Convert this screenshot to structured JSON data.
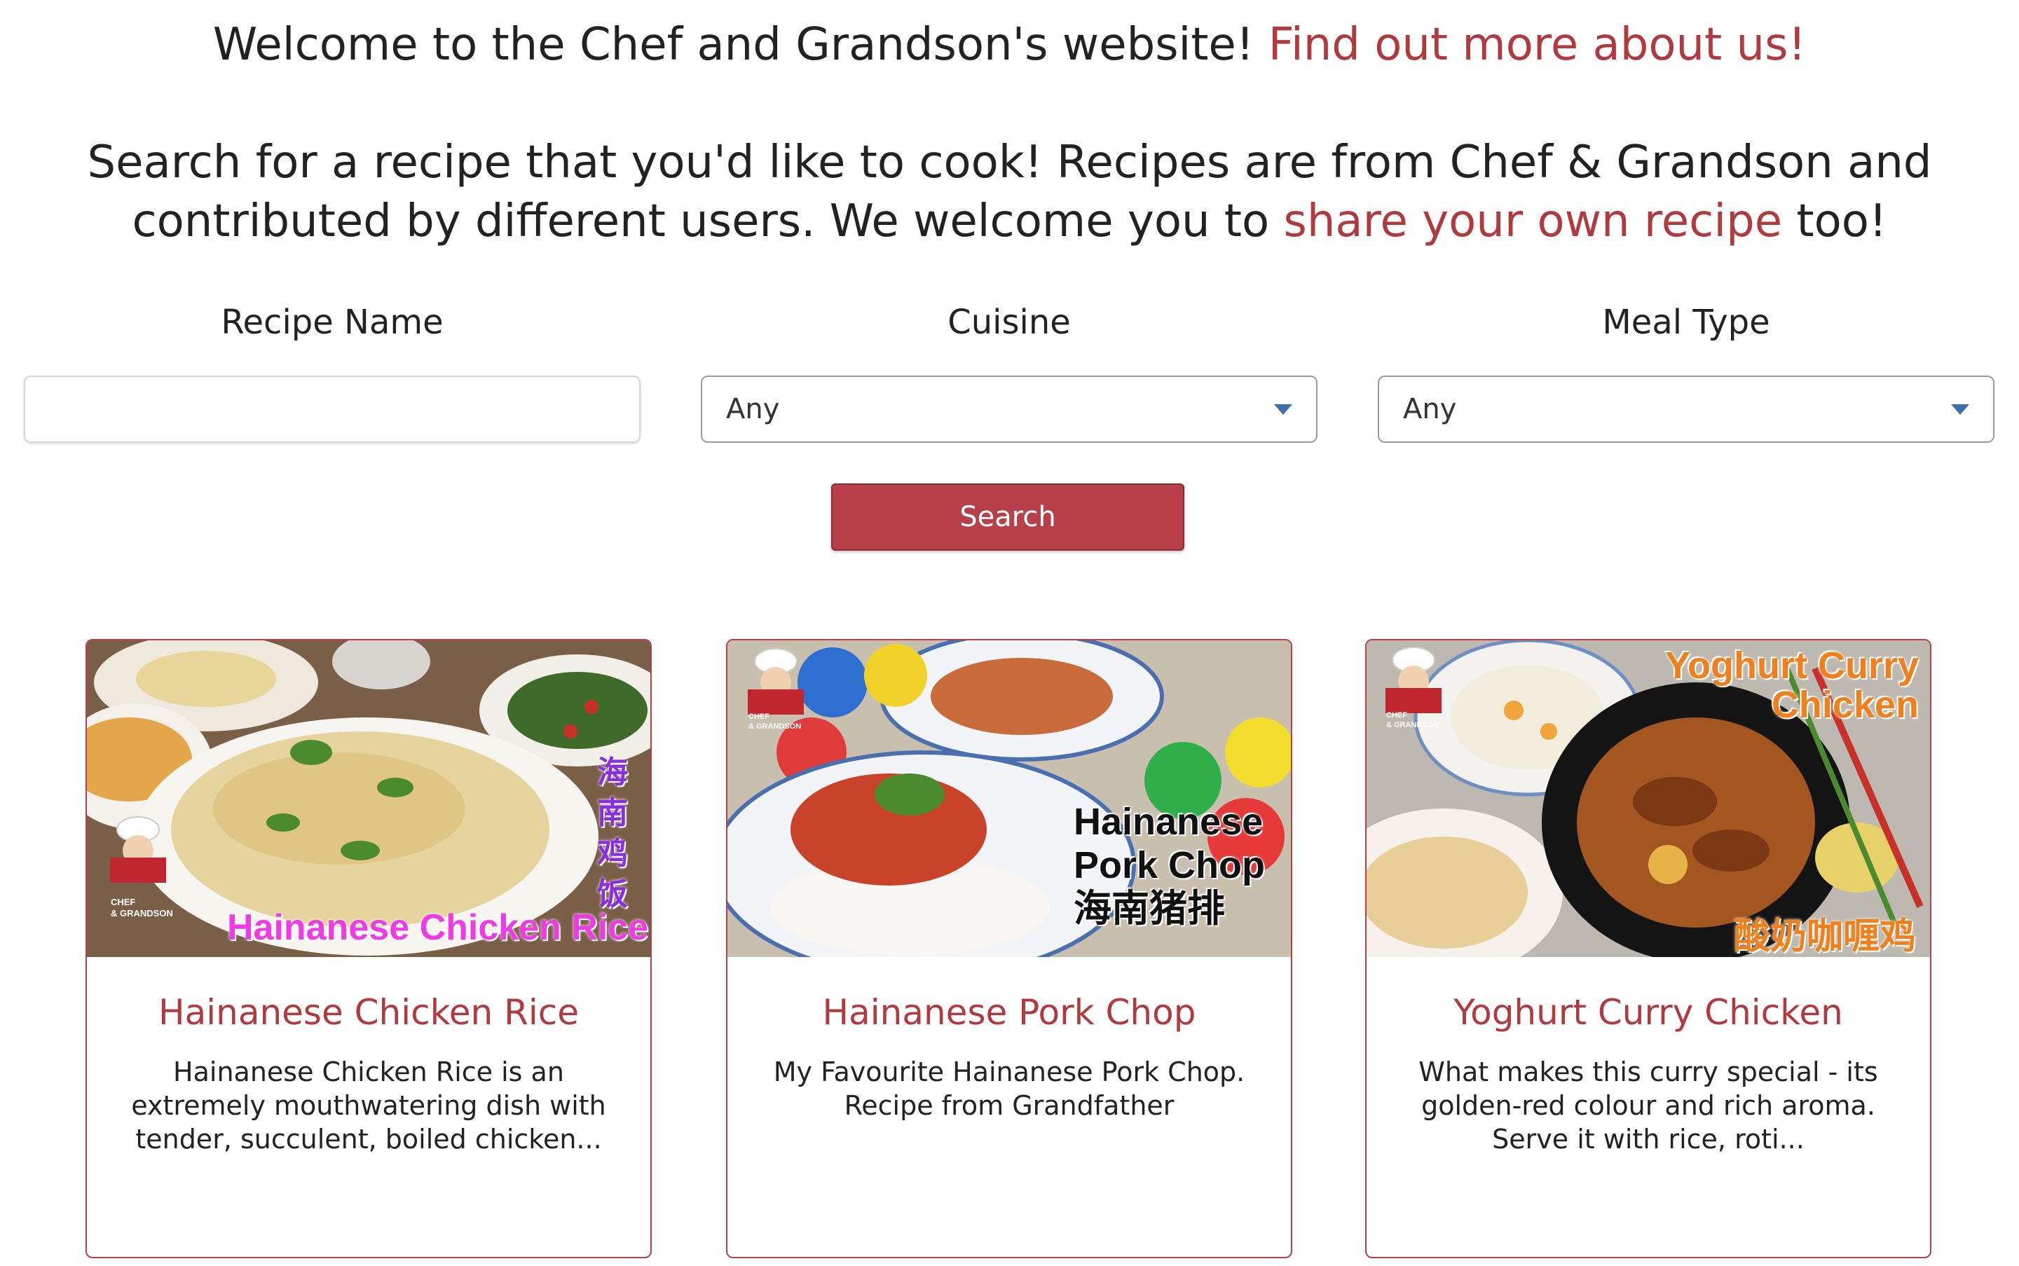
{
  "intro": {
    "welcome_text": "Welcome to the Chef and Grandson's website!",
    "about_link": "Find out more about us!",
    "search_line1": "Search for a recipe that you'd like to cook! Recipes are from Chef & Grandson and",
    "search_line2_pre": "contributed by different users. We welcome you to",
    "share_link": "share your own recipe",
    "search_line2_post": "too!"
  },
  "filters": {
    "recipe_name_label": "Recipe Name",
    "recipe_name_value": "",
    "recipe_name_placeholder": "",
    "cuisine_label": "Cuisine",
    "cuisine_value": "Any",
    "meal_type_label": "Meal Type",
    "meal_type_value": "Any",
    "search_button": "Search"
  },
  "cards": [
    {
      "title": "Hainanese Chicken Rice",
      "description": "Hainanese Chicken Rice is an extremely mouthwatering dish with tender, succulent, boiled chicken...",
      "overlay_en": "Hainanese Chicken Rice",
      "overlay_cn": "海南鸡饭"
    },
    {
      "title": "Hainanese Pork Chop",
      "description": "My Favourite Hainanese Pork Chop. Recipe from Grandfather",
      "overlay_en_1": "Hainanese",
      "overlay_en_2": "Pork Chop",
      "overlay_cn": "海南猪排"
    },
    {
      "title": "Yoghurt Curry Chicken",
      "description": "What makes this curry special - its golden-red colour and rich aroma. Serve it with rice, roti...",
      "overlay_en_1": "Yoghurt Curry",
      "overlay_en_2": "Chicken",
      "overlay_cn": "酸奶咖喱鸡"
    }
  ],
  "badge_text": {
    "line1": "CHEF",
    "line2": "& GRANDSON"
  },
  "colors": {
    "accent": "#b03a3e",
    "button": "#b7404a",
    "caret": "#3e6fae"
  }
}
